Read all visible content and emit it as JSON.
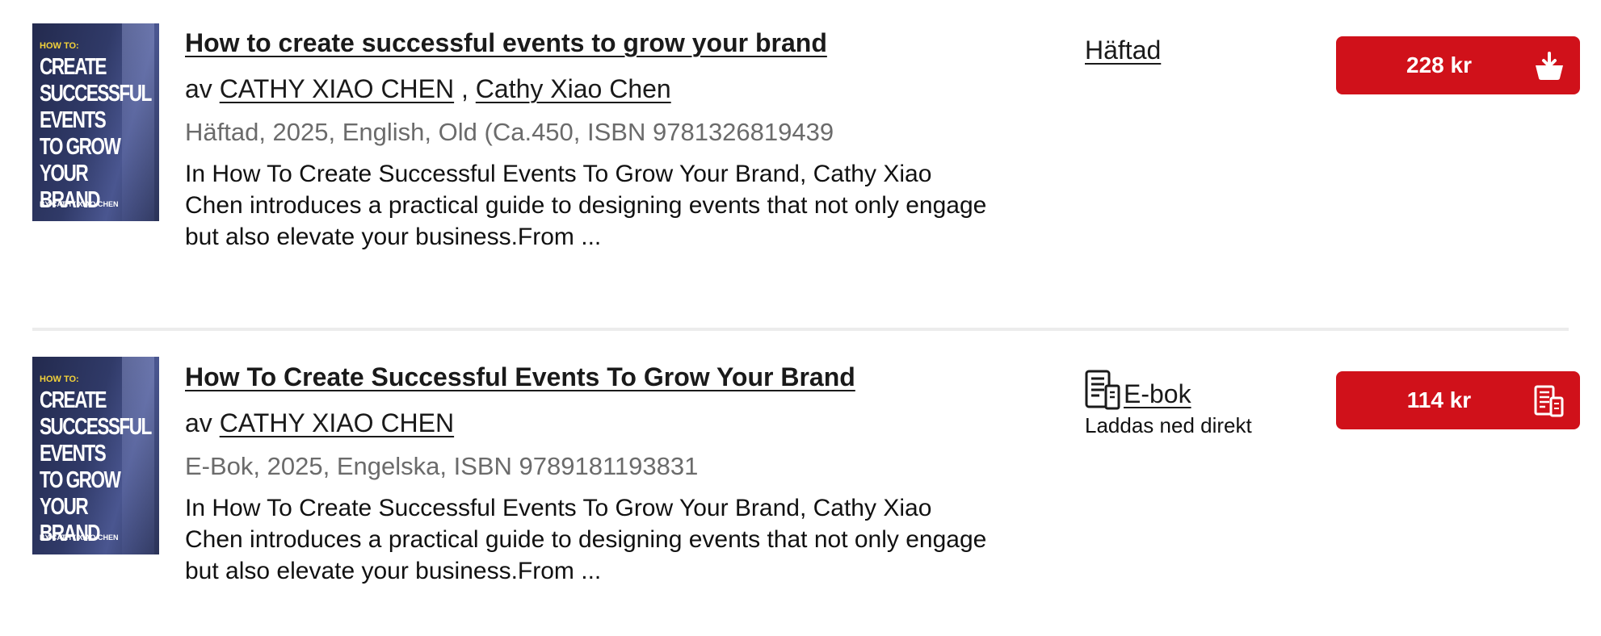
{
  "products": [
    {
      "cover": {
        "howto": "HOW TO:",
        "title": "CREATE SUCCESSFUL EVENTS TO GROW YOUR BRAND",
        "by": "BY CATHY XIAO CHEN"
      },
      "title": "How to create successful events to grow your brand",
      "by_prefix": "av",
      "authors": [
        "CATHY XIAO CHEN",
        "Cathy Xiao Chen"
      ],
      "meta": "Häftad, 2025, English, Old (Ca.450, ISBN 9781326819439",
      "description": "In How To Create Successful Events To Grow Your Brand, Cathy Xiao Chen introduces a practical guide to designing events that not only engage but also elevate your business.From ...",
      "format": "Häftad",
      "price": "228 kr",
      "button_icon": "basket-icon"
    },
    {
      "cover": {
        "howto": "HOW TO:",
        "title": "CREATE SUCCESSFUL EVENTS TO GROW YOUR BRAND",
        "by": "BY CATHY XIAO CHEN"
      },
      "title": "How To Create Successful Events To Grow Your Brand",
      "by_prefix": "av",
      "authors": [
        "CATHY XIAO CHEN"
      ],
      "meta": "E-Bok, 2025, Engelska, ISBN 9789181193831",
      "description": "In How To Create Successful Events To Grow Your Brand, Cathy Xiao Chen introduces a practical guide to designing events that not only engage but also elevate your business.From ...",
      "format": "E-bok",
      "format_icon": "ebook-icon",
      "format_note": "Laddas ned direkt",
      "price": "114 kr",
      "button_icon": "ebook-icon"
    }
  ],
  "colors": {
    "accent": "#d0111a",
    "meta_text": "#6b6b6b",
    "divider": "#ececec"
  }
}
